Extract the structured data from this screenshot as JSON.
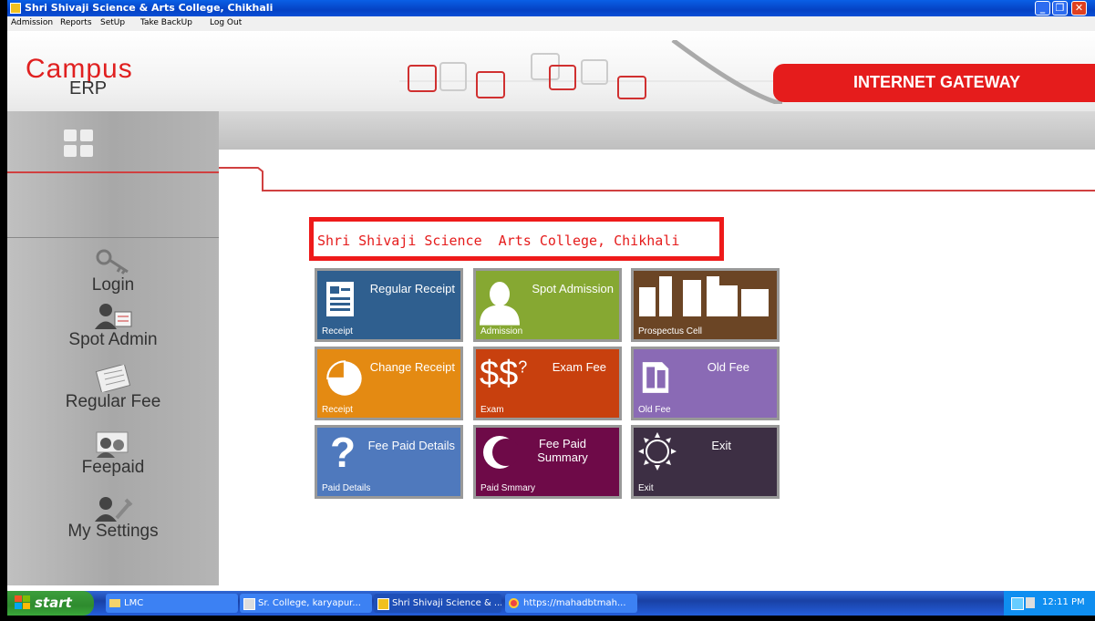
{
  "window": {
    "title": "Shri Shivaji Science & Arts College, Chikhali"
  },
  "menu": [
    "Admission",
    "Reports",
    "SetUp",
    "Take BackUp",
    "Log Out"
  ],
  "header": {
    "logo_top": "Campus",
    "logo_bottom": "ERP",
    "gateway": "INTERNET GATEWAY"
  },
  "sidebar": {
    "items": [
      "Login",
      "Spot Admin",
      "Regular Fee",
      "Feepaid",
      "My Settings"
    ]
  },
  "college_name": "Shri Shivaji Science  Arts College, Chikhali",
  "tiles": [
    {
      "title": "Regular Receipt",
      "sub": "Receipt",
      "color": "#2f5f8f",
      "icon": "receipt-icon"
    },
    {
      "title": "Spot Admission",
      "sub": "Admission",
      "color": "#86a832",
      "icon": "person-icon"
    },
    {
      "title": "",
      "sub": "Prospectus Cell",
      "color": "#6b4525",
      "icon": "bar-icon"
    },
    {
      "title": "Change Receipt",
      "sub": "Receipt",
      "color": "#e48a12",
      "icon": "pie-icon"
    },
    {
      "title": "Exam Fee",
      "sub": "Exam",
      "color": "#c8400e",
      "icon": "dollar-icon"
    },
    {
      "title": "Old Fee",
      "sub": "Old Fee",
      "color": "#8a6ab5",
      "icon": "document-icon"
    },
    {
      "title": "Fee Paid Details",
      "sub": "Paid Details",
      "color": "#4f79bd",
      "icon": "question-icon"
    },
    {
      "title": "Fee Paid Summary",
      "sub": "Paid Smmary",
      "color": "#6e0a48",
      "icon": "moon-icon"
    },
    {
      "title": "Exit",
      "sub": "Exit",
      "color": "#3d2f44",
      "icon": "sun-icon"
    }
  ],
  "taskbar": {
    "start": "start",
    "buttons": [
      "LMC",
      "Sr. College, karyapur...",
      "Shri Shivaji Science & ...",
      "https://mahadbtmah..."
    ],
    "clock": "12:11 PM"
  }
}
